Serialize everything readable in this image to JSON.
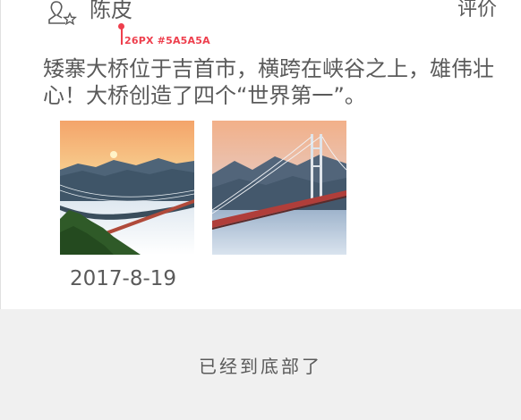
{
  "review": {
    "user_name": "陈皮",
    "review_button": "评价",
    "text": "矮寨大桥位于吉首市，横跨在峡谷之上，雄伟壮\n心！大桥创造了四个“世界第一”。",
    "date": "2017-8-19",
    "photos": [
      "bridge-sunrise-photo",
      "bridge-tower-photo"
    ]
  },
  "annotation": {
    "label": "26PX #5A5A5A"
  },
  "footer": {
    "end_text": "已经到底部了"
  },
  "colors": {
    "text": "#5A5A5A",
    "annotation": "#EE3F4D",
    "footer_bg": "#F0F0F0"
  },
  "icons": [
    "user-avatar-icon"
  ]
}
